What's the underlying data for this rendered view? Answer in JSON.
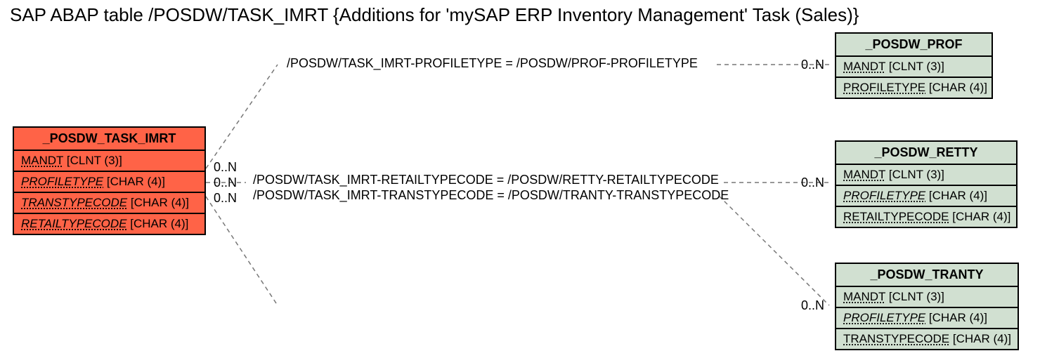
{
  "title": "SAP ABAP table /POSDW/TASK_IMRT {Additions for 'mySAP ERP Inventory Management' Task (Sales)}",
  "entities": {
    "task_imrt": {
      "name": "_POSDW_TASK_IMRT",
      "fields": {
        "f0": {
          "name": "MANDT",
          "type": "[CLNT (3)]"
        },
        "f1": {
          "name": "PROFILETYPE",
          "type": "[CHAR (4)]"
        },
        "f2": {
          "name": "TRANSTYPECODE",
          "type": "[CHAR (4)]"
        },
        "f3": {
          "name": "RETAILTYPECODE",
          "type": "[CHAR (4)]"
        }
      }
    },
    "prof": {
      "name": "_POSDW_PROF",
      "fields": {
        "f0": {
          "name": "MANDT",
          "type": "[CLNT (3)]"
        },
        "f1": {
          "name": "PROFILETYPE",
          "type": "[CHAR (4)]"
        }
      }
    },
    "retty": {
      "name": "_POSDW_RETTY",
      "fields": {
        "f0": {
          "name": "MANDT",
          "type": "[CLNT (3)]"
        },
        "f1": {
          "name": "PROFILETYPE",
          "type": "[CHAR (4)]"
        },
        "f2": {
          "name": "RETAILTYPECODE",
          "type": "[CHAR (4)]"
        }
      }
    },
    "tranty": {
      "name": "_POSDW_TRANTY",
      "fields": {
        "f0": {
          "name": "MANDT",
          "type": "[CLNT (3)]"
        },
        "f1": {
          "name": "PROFILETYPE",
          "type": "[CHAR (4)]"
        },
        "f2": {
          "name": "TRANSTYPECODE",
          "type": "[CHAR (4)]"
        }
      }
    }
  },
  "relations": {
    "r0": "/POSDW/TASK_IMRT-PROFILETYPE = /POSDW/PROF-PROFILETYPE",
    "r1": "/POSDW/TASK_IMRT-RETAILTYPECODE = /POSDW/RETTY-RETAILTYPECODE",
    "r2": "/POSDW/TASK_IMRT-TRANSTYPECODE = /POSDW/TRANTY-TRANSTYPECODE"
  },
  "mult": "0..N"
}
